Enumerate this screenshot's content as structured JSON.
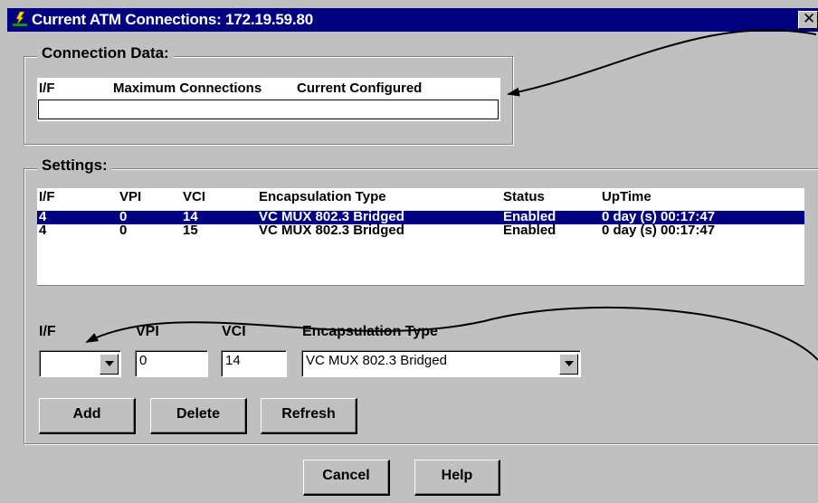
{
  "window": {
    "title": "Current ATM Connections: 172.19.59.80",
    "close_glyph": "✕",
    "app_icon": "lightning-network-icon"
  },
  "connection_data": {
    "label": "Connection Data:",
    "headers": [
      "I/F",
      "Maximum Connections",
      "Current Configured"
    ],
    "rows": []
  },
  "settings": {
    "label": "Settings:",
    "headers": [
      "I/F",
      "VPI",
      "VCI",
      "Encapsulation Type",
      "Status",
      "UpTime"
    ],
    "rows": [
      [
        "4",
        "0",
        "14",
        "VC MUX 802.3 Bridged",
        "Enabled",
        "0 day (s) 00:17:47"
      ],
      [
        "4",
        "0",
        "15",
        "VC MUX 802.3 Bridged",
        "Enabled",
        "0 day (s) 00:17:47"
      ]
    ],
    "selected_row": 0
  },
  "form": {
    "if_label": "I/F",
    "if_value": "",
    "vpi_label": "VPI",
    "vpi_value": "0",
    "vci_label": "VCI",
    "vci_value": "14",
    "encap_label": "Encapsulation Type",
    "encap_value": "VC MUX 802.3 Bridged"
  },
  "buttons": {
    "add": "Add",
    "delete": "Delete",
    "refresh": "Refresh",
    "cancel": "Cancel",
    "help": "Help"
  },
  "colors": {
    "titlebar": "#000080",
    "selection": "#000080",
    "face": "#c0c0c0"
  }
}
